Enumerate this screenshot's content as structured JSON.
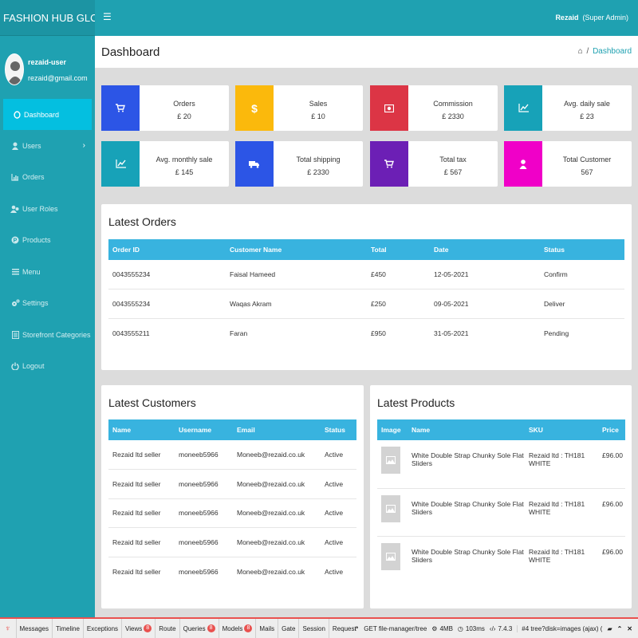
{
  "brand": "FASHION HUB GLOBAL",
  "user": {
    "name": "rezaid-user",
    "email": "rezaid@gmail.com"
  },
  "topbar": {
    "admin_name": "Rezaid",
    "admin_role": "(Super Admin)"
  },
  "page": {
    "title": "Dashboard",
    "breadcrumb_sep": "/",
    "breadcrumb_current": "Dashboard"
  },
  "menu": [
    {
      "label": "Dashboard",
      "icon": "circle-icon"
    },
    {
      "label": "Users",
      "icon": "user-icon"
    },
    {
      "label": "Orders",
      "icon": "bar-chart-icon"
    },
    {
      "label": "User Roles",
      "icon": "users-icon"
    },
    {
      "label": "Products",
      "icon": "product-icon"
    },
    {
      "label": "Menu",
      "icon": "menu-icon"
    },
    {
      "label": "Settings",
      "icon": "gears-icon"
    },
    {
      "label": "Storefront Categories",
      "icon": "list-icon"
    },
    {
      "label": "Logout",
      "icon": "power-icon"
    }
  ],
  "stats": [
    {
      "label": "Orders",
      "value": "£ 20",
      "color": "#2c55e6",
      "icon": "cart-icon"
    },
    {
      "label": "Sales",
      "value": "£ 10",
      "color": "#fbb90c",
      "icon": "dollar-icon"
    },
    {
      "label": "Commission",
      "value": "£ 2330",
      "color": "#dc3545",
      "icon": "money-icon"
    },
    {
      "label": "Avg. daily sale",
      "value": "£ 23",
      "color": "#17a2b8",
      "icon": "chart-line-icon"
    },
    {
      "label": "Avg. monthly sale",
      "value": "£ 145",
      "color": "#17a2b8",
      "icon": "chart-line-icon"
    },
    {
      "label": "Total shipping",
      "value": "£ 2330",
      "color": "#2c55e6",
      "icon": "truck-icon"
    },
    {
      "label": "Total tax",
      "value": "£ 567",
      "color": "#6c1fb5",
      "icon": "cart-icon"
    },
    {
      "label": "Total Customer",
      "value": "567",
      "color": "#f000c8",
      "icon": "user-icon"
    }
  ],
  "latest_orders": {
    "title": "Latest Orders",
    "headers": [
      "Order ID",
      "Customer Name",
      "Total",
      "Date",
      "Status"
    ],
    "rows": [
      [
        "0043555234",
        "Faisal Hameed",
        "£450",
        "12-05-2021",
        "Confirm"
      ],
      [
        "0043555234",
        "Waqas Akram",
        "£250",
        "09-05-2021",
        "Deliver"
      ],
      [
        "0043555211",
        "Faran",
        "£950",
        "31-05-2021",
        "Pending"
      ]
    ]
  },
  "latest_customers": {
    "title": "Latest Customers",
    "headers": [
      "Name",
      "Username",
      "Email",
      "Status"
    ],
    "rows": [
      [
        "Rezaid ltd seller",
        "moneeb5966",
        "Moneeb@rezaid.co.uk",
        "Active"
      ],
      [
        "Rezaid ltd seller",
        "moneeb5966",
        "Moneeb@rezaid.co.uk",
        "Active"
      ],
      [
        "Rezaid ltd seller",
        "moneeb5966",
        "Moneeb@rezaid.co.uk",
        "Active"
      ],
      [
        "Rezaid ltd seller",
        "moneeb5966",
        "Moneeb@rezaid.co.uk",
        "Active"
      ],
      [
        "Rezaid ltd seller",
        "moneeb5966",
        "Moneeb@rezaid.co.uk",
        "Active"
      ]
    ]
  },
  "latest_products": {
    "title": "Latest Products",
    "headers": [
      "Image",
      "Name",
      "SKU",
      "Price"
    ],
    "rows": [
      [
        "",
        "White Double Strap Chunky Sole Flat Sliders",
        "Rezaid ltd : TH181 WHITE",
        "£96.00"
      ],
      [
        "",
        "White Double Strap Chunky Sole Flat Sliders",
        "Rezaid ltd : TH181 WHITE",
        "£96.00"
      ],
      [
        "",
        "White Double Strap Chunky Sole Flat Sliders",
        "Rezaid ltd : TH181 WHITE",
        "£96.00"
      ]
    ]
  },
  "debugbar": {
    "tabs": [
      {
        "label": "Messages",
        "badge": ""
      },
      {
        "label": "Timeline",
        "badge": ""
      },
      {
        "label": "Exceptions",
        "badge": ""
      },
      {
        "label": "Views",
        "badge": "8"
      },
      {
        "label": "Route",
        "badge": ""
      },
      {
        "label": "Queries",
        "badge": "8"
      },
      {
        "label": "Models",
        "badge": "8"
      },
      {
        "label": "Mails",
        "badge": ""
      },
      {
        "label": "Gate",
        "badge": ""
      },
      {
        "label": "Session",
        "badge": ""
      },
      {
        "label": "Request",
        "badge": ""
      }
    ],
    "request": "GET file-manager/tree",
    "memory": "4MB",
    "time": "103ms",
    "php": "7.4.3",
    "ajax": "#4 tree?disk=images (ajax) ("
  }
}
